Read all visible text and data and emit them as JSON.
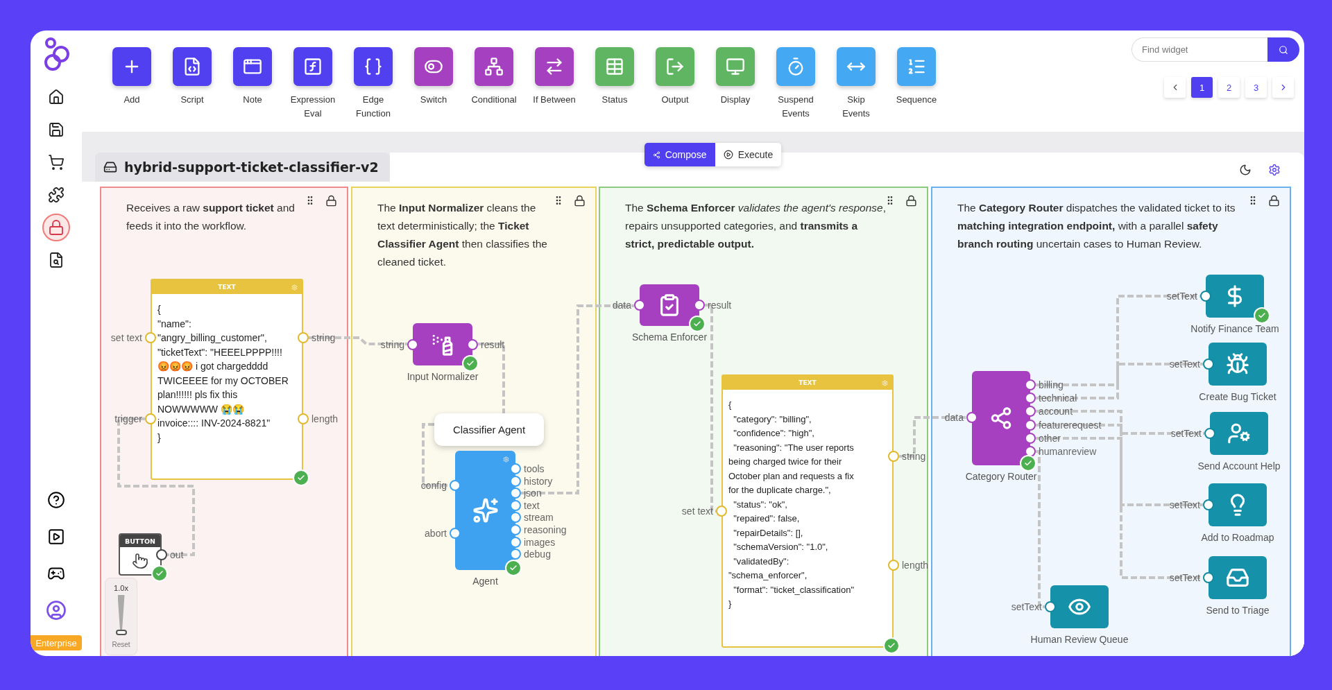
{
  "sidebar": {
    "items": [
      {
        "selected": false
      },
      {
        "selected": false
      },
      {
        "selected": false
      },
      {
        "selected": false
      },
      {
        "selected": true
      },
      {
        "selected": false
      }
    ],
    "badge": "Enterprise"
  },
  "toolbar": {
    "tools": [
      {
        "label": "Add",
        "color": "#5140f0"
      },
      {
        "label": "Script",
        "color": "#5140f0"
      },
      {
        "label": "Note",
        "color": "#5140f0"
      },
      {
        "label": "Expression Eval",
        "color": "#5140f0"
      },
      {
        "label": "Edge Function",
        "color": "#5140f0"
      },
      {
        "label": "Switch",
        "color": "#a541c1"
      },
      {
        "label": "Conditional",
        "color": "#a541c1"
      },
      {
        "label": "If Between",
        "color": "#a541c1"
      },
      {
        "label": "Status",
        "color": "#5fb562"
      },
      {
        "label": "Output",
        "color": "#5fb562"
      },
      {
        "label": "Display",
        "color": "#5fb562"
      },
      {
        "label": "Suspend Events",
        "color": "#44a8f2"
      },
      {
        "label": "Skip Events",
        "color": "#44a8f2"
      },
      {
        "label": "Sequence",
        "color": "#44a8f2"
      }
    ]
  },
  "search": {
    "placeholder": "Find widget"
  },
  "pagination": {
    "pages": [
      {
        "label": "1",
        "selected": true
      },
      {
        "label": "2",
        "selected": false
      },
      {
        "label": "3",
        "selected": false
      }
    ]
  },
  "mode_tabs": [
    {
      "label": "Compose",
      "selected": true
    },
    {
      "label": "Execute",
      "selected": false
    }
  ],
  "workflow": {
    "title": "hybrid-support-ticket-classifier-v2"
  },
  "groups": [
    {
      "color": "#ef8a8a",
      "description": "Receives a raw **support ticket**  and feeds it into the workflow.",
      "nodes": [
        {
          "kind": "text",
          "header": "TEXT",
          "content": "{\n\"name\":\n\"angry_billing_customer\",\n\"ticketText\": \"HEEELPPPP!!!!\n😡😡😡 i got chargedddd\nTWICEEEE for my OCTOBER\nplan!!!!!! pls fix this\nNOWWWWW 😭😭\ninvoice:::: INV-2024-8821\"\n}",
          "inputs": [
            "set text",
            "trigger"
          ],
          "outputs": [
            "string",
            "length"
          ],
          "done": true
        },
        {
          "kind": "button",
          "header": "BUTTON",
          "outputs": [
            "out"
          ],
          "done": true
        }
      ]
    },
    {
      "color": "#e6d55a",
      "description": "The **Input Normalizer** cleans the text deterministically; the **Ticket Classifier Agent** then classifies the cleaned ticket.",
      "nodes": [
        {
          "kind": "function",
          "label": "Input Normalizer",
          "inputs": [
            "string"
          ],
          "outputs": [
            "result"
          ],
          "done": true
        },
        {
          "kind": "agent_label",
          "label": "Classifier Agent"
        },
        {
          "kind": "agent",
          "label": "Agent",
          "inputs": [
            "config",
            "abort"
          ],
          "outputs": [
            "tools",
            "history",
            "json",
            "text",
            "stream",
            "reasoning",
            "images",
            "debug"
          ],
          "done": true
        }
      ]
    },
    {
      "color": "#8ccb7e",
      "description": "The **Schema Enforcer**  *validates the agent's response*, repairs unsupported categories, and **transmits a strict, predictable output.**",
      "nodes": [
        {
          "kind": "function",
          "label": "Schema Enforcer",
          "inputs": [
            "data"
          ],
          "outputs": [
            "result"
          ],
          "done": true
        },
        {
          "kind": "text",
          "header": "TEXT",
          "content": "{\n  \"category\": \"billing\",\n  \"confidence\": \"high\",\n  \"reasoning\": \"The user reports\nbeing charged twice for their\nOctober plan and requests a fix\nfor the duplicate charge.\",\n  \"status\": \"ok\",\n  \"repaired\": false,\n  \"repairDetails\": [],\n  \"schemaVersion\": \"1.0\",\n  \"validatedBy\":\n\"schema_enforcer\",\n  \"format\": \"ticket_classification\"\n}",
          "inputs": [
            "set text"
          ],
          "outputs": [
            "string",
            "length"
          ],
          "done": true
        }
      ]
    },
    {
      "color": "#69b1ee",
      "description": "The **Category Router** dispatches the validated ticket to its **matching integration endpoint,** with a parallel **safety branch routing** uncertain cases to Human Review.",
      "nodes": [
        {
          "kind": "function",
          "label": "Category Router",
          "inputs": [
            "data"
          ],
          "outputs": [
            "billing",
            "technical",
            "account",
            "featurerequest",
            "other",
            "humanreview"
          ],
          "done": true
        },
        {
          "kind": "action",
          "label": "Notify Finance Team",
          "inputs": [
            "setText"
          ],
          "done": true
        },
        {
          "kind": "action",
          "label": "Create Bug Ticket",
          "inputs": [
            "setText"
          ],
          "done": false
        },
        {
          "kind": "action",
          "label": "Send Account Help",
          "inputs": [
            "setText"
          ],
          "done": false
        },
        {
          "kind": "action",
          "label": "Add to Roadmap",
          "inputs": [
            "setText"
          ],
          "done": false
        },
        {
          "kind": "action",
          "label": "Send to Triage",
          "inputs": [
            "setText"
          ],
          "done": false
        },
        {
          "kind": "action",
          "label": "Human Review Queue",
          "inputs": [
            "setText"
          ],
          "done": false
        }
      ]
    }
  ],
  "speed_control": {
    "value": "1.0x",
    "level": 0,
    "reset": "Reset"
  }
}
